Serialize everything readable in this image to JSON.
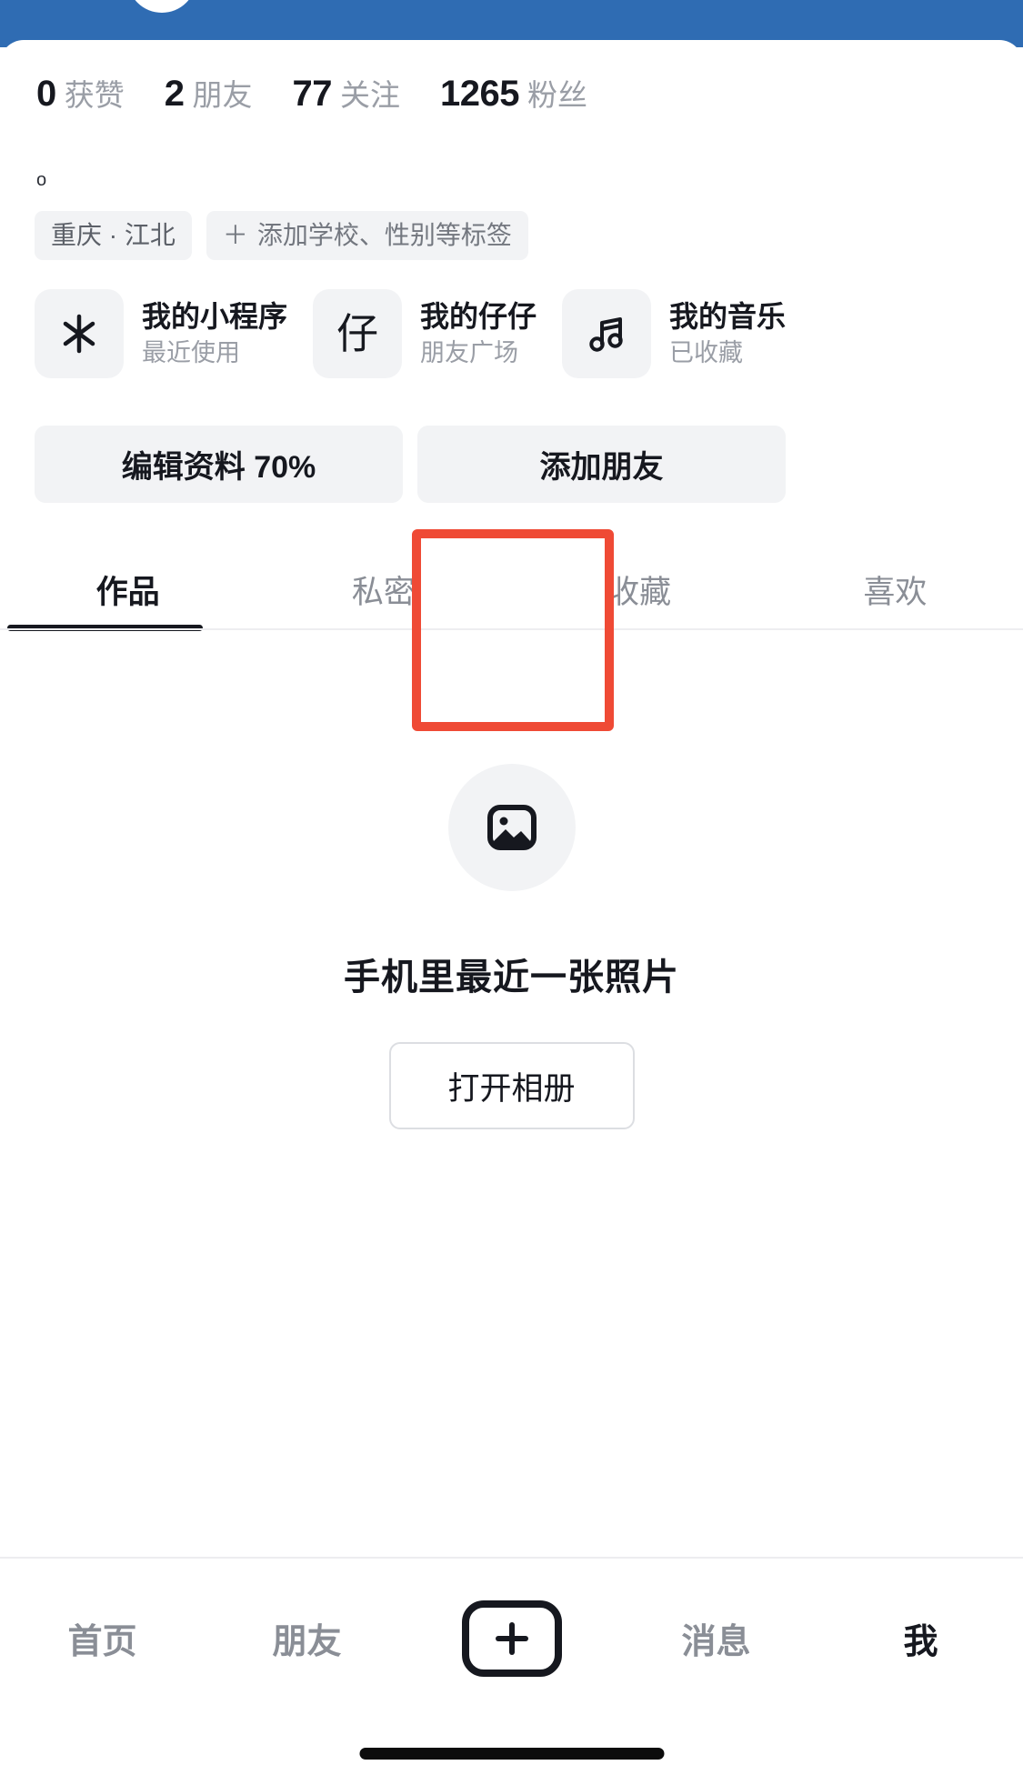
{
  "theme": {
    "banner_color": "#2f6cb3",
    "accent_highlight": "#ef4a35",
    "chip_bg": "#f2f3f5",
    "text_primary": "#16181f",
    "text_muted": "#9a9ea6"
  },
  "stats": [
    {
      "value": "0",
      "label": "获赞"
    },
    {
      "value": "2",
      "label": "朋友"
    },
    {
      "value": "77",
      "label": "关注"
    },
    {
      "value": "1265",
      "label": "粉丝"
    }
  ],
  "bio": "o",
  "tags": [
    {
      "icon": "",
      "label": "重庆 · 江北"
    },
    {
      "icon": "＋",
      "label": "添加学校、性别等标签"
    }
  ],
  "mini_apps": [
    {
      "icon": "✳",
      "icon_name": "asterisk-icon",
      "title": "我的小程序",
      "subtitle": "最近使用"
    },
    {
      "icon": "仔",
      "icon_name": "zaizai-icon",
      "title": "我的仔仔",
      "subtitle": "朋友广场"
    },
    {
      "icon": "♫",
      "icon_name": "music-note-icon",
      "title": "我的音乐",
      "subtitle": "已收藏"
    }
  ],
  "actions": [
    {
      "label": "编辑资料 70%"
    },
    {
      "label": "添加朋友"
    }
  ],
  "tabs": [
    {
      "label": "作品",
      "active": true
    },
    {
      "label": "私密",
      "active": false
    },
    {
      "label": "收藏",
      "active": false,
      "highlighted": true
    },
    {
      "label": "喜欢",
      "active": false
    }
  ],
  "empty_state": {
    "icon": "image-icon",
    "title": "手机里最近一张照片",
    "button_label": "打开相册"
  },
  "bottom_nav": [
    {
      "label": "首页",
      "active": false,
      "type": "text"
    },
    {
      "label": "朋友",
      "active": false,
      "type": "text"
    },
    {
      "label": "",
      "active": false,
      "type": "plus"
    },
    {
      "label": "消息",
      "active": false,
      "type": "text"
    },
    {
      "label": "我",
      "active": true,
      "type": "text"
    }
  ]
}
